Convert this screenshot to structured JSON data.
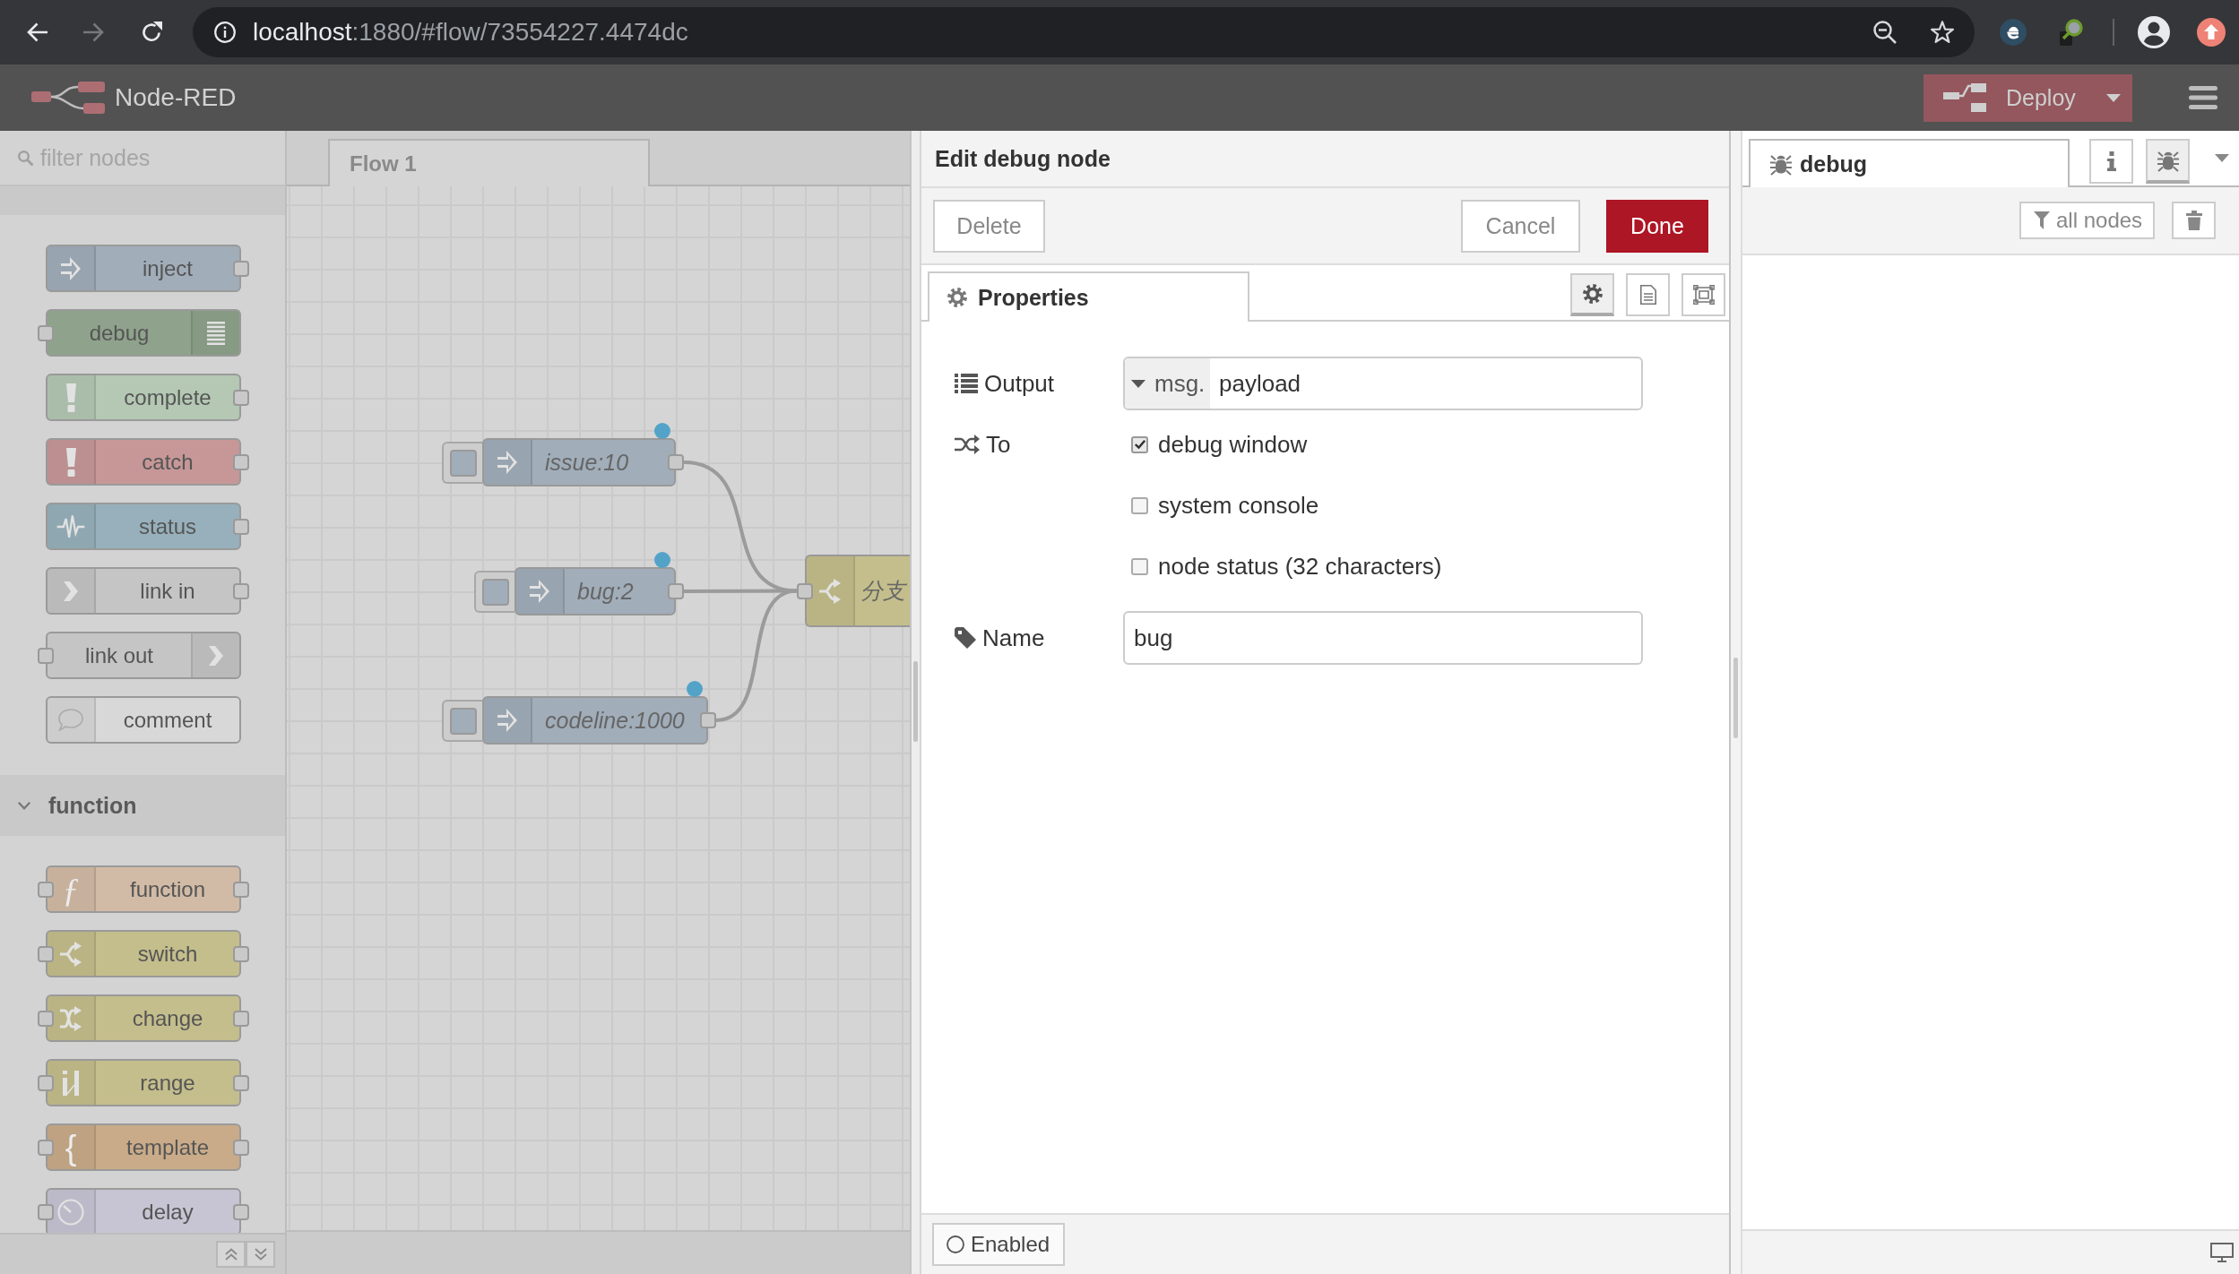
{
  "browser": {
    "url": "localhost:1880/#flow/73554227.4474dc",
    "forward_disabled": true
  },
  "header": {
    "title": "Node-RED",
    "deploy": "Deploy"
  },
  "palette": {
    "search": {
      "placeholder": "filter nodes"
    },
    "categories": [
      {
        "expanded": true,
        "nodes": [
          {
            "label": "inject",
            "kind": "inject",
            "color": "#a1adb9",
            "input": false,
            "output": true
          },
          {
            "label": "debug",
            "kind": "debug",
            "color": "#8fa38c",
            "input": true,
            "output": false
          },
          {
            "label": "complete",
            "kind": "complete",
            "color": "#b4c8b4",
            "input": false,
            "output": true
          },
          {
            "label": "catch",
            "kind": "catch",
            "color": "#c79798",
            "input": false,
            "output": true
          },
          {
            "label": "status",
            "kind": "status",
            "color": "#97b0bb",
            "input": false,
            "output": true
          },
          {
            "label": "link in",
            "kind": "link_in",
            "color": "#c5c5c5",
            "input": false,
            "output": true
          },
          {
            "label": "link out",
            "kind": "link_out",
            "color": "#c5c5c5",
            "input": true,
            "output": false
          },
          {
            "label": "comment",
            "kind": "comment",
            "color": "#d8d8d8",
            "input": false,
            "output": false
          }
        ]
      },
      {
        "label": "function",
        "expanded": true,
        "nodes": [
          {
            "label": "function",
            "kind": "function",
            "icon_text": "ƒ",
            "color": "#d2bba6",
            "input": true,
            "output": true
          },
          {
            "label": "switch",
            "kind": "switch",
            "color": "#c4be8c",
            "input": true,
            "output": true
          },
          {
            "label": "change",
            "kind": "change",
            "color": "#c4be8c",
            "input": true,
            "output": true
          },
          {
            "label": "range",
            "kind": "range",
            "color": "#c4be8c",
            "input": true,
            "output": true
          },
          {
            "label": "template",
            "kind": "template",
            "icon_text": "{",
            "color": "#c9ab89",
            "input": true,
            "output": true
          },
          {
            "label": "delay",
            "kind": "delay",
            "color": "#c7c5d3",
            "input": true,
            "output": true
          }
        ]
      }
    ]
  },
  "workspace": {
    "tabs": [
      {
        "label": "Flow 1",
        "selected": true
      }
    ],
    "nodes": [
      {
        "label": "issue:10",
        "kind": "inject",
        "color": "#a1adb9",
        "changed": true,
        "input": false,
        "output": true,
        "wired": true
      },
      {
        "label": "bug:2",
        "kind": "inject",
        "color": "#a1adb9",
        "changed": true,
        "input": false,
        "output": true,
        "wired": true
      },
      {
        "label": "codeline:1000",
        "kind": "inject",
        "color": "#a1adb9",
        "changed": true,
        "input": false,
        "output": true,
        "wired": true
      },
      {
        "label": "分支",
        "kind": "switch",
        "color": "#c4be8c",
        "changed": false,
        "input": true
      }
    ]
  },
  "editor": {
    "title": "Edit debug node",
    "buttons": [
      {
        "kind": "delete",
        "label": "Delete"
      },
      {
        "kind": "cancel",
        "label": "Cancel"
      },
      {
        "kind": "done",
        "label": "Done"
      }
    ],
    "tabs": [
      {
        "label": "Properties",
        "selected": true
      }
    ],
    "tab_buttons": [
      {
        "kind": "properties",
        "selected": true
      },
      {
        "kind": "description",
        "selected": false
      },
      {
        "kind": "appearance",
        "selected": false
      }
    ],
    "fields": [
      {
        "kind": "typed",
        "label": "Output",
        "type": "msg.",
        "value": "payload"
      },
      {
        "kind": "checks",
        "label": "To",
        "options": [
          {
            "label": "debug window",
            "checked": true
          },
          {
            "label": "system console",
            "checked": false
          },
          {
            "label": "node status (32 characters)",
            "checked": false
          }
        ]
      },
      {
        "kind": "text",
        "label": "Name",
        "value": "bug"
      }
    ],
    "footer": {
      "toggle": "Enabled"
    }
  },
  "sidebar": {
    "tabs": [
      {
        "label": "debug",
        "selected": true
      }
    ],
    "tab_buttons": [
      {
        "kind": "info",
        "selected": false
      },
      {
        "kind": "debug",
        "selected": true
      }
    ],
    "filter": "all nodes"
  }
}
